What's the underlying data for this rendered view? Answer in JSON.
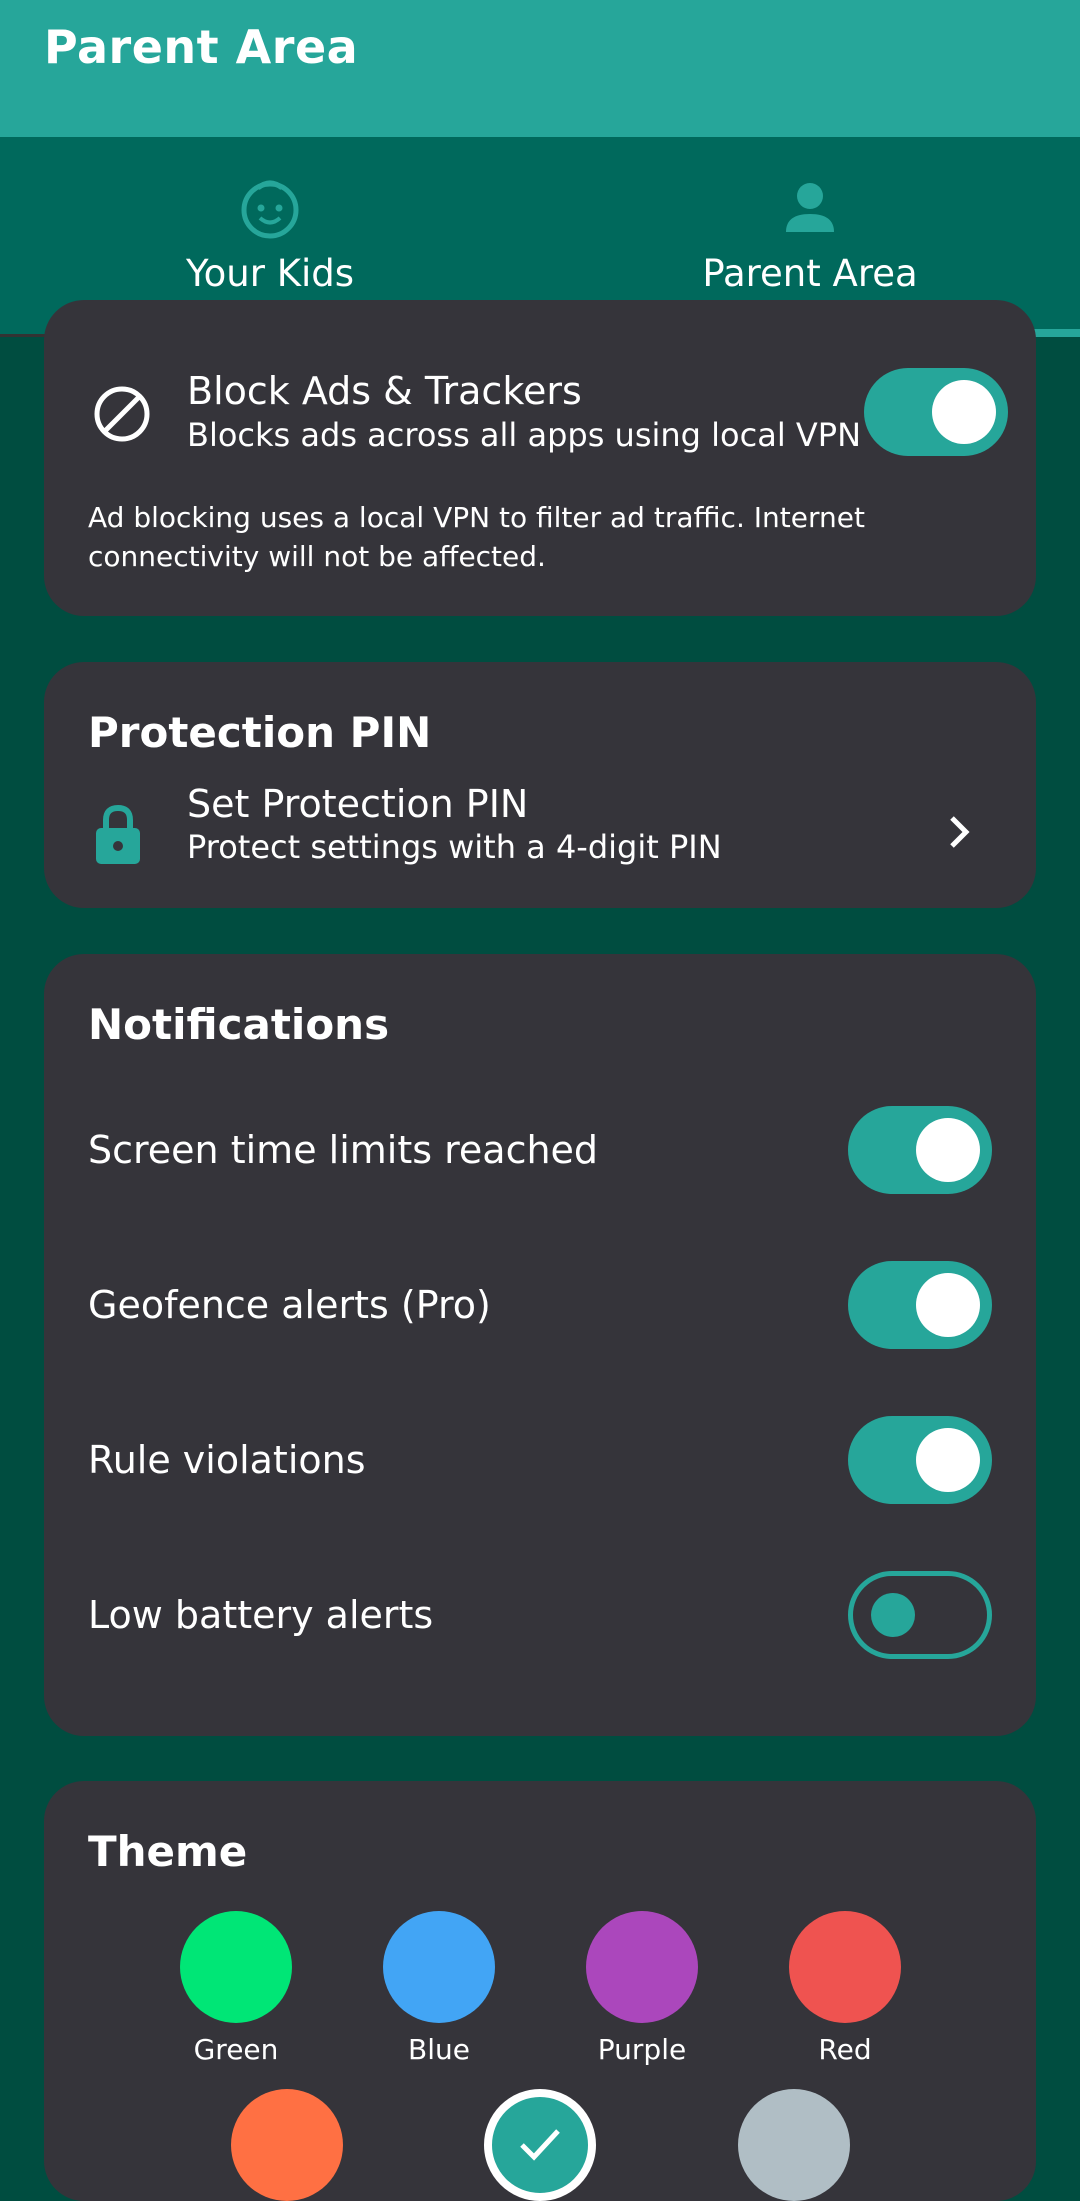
{
  "appbar": {
    "title": "Parent Area"
  },
  "tabs": [
    {
      "label": "Your Kids",
      "icon": "child-face-icon",
      "selected": false
    },
    {
      "label": "Parent Area",
      "icon": "person-icon",
      "selected": true
    }
  ],
  "ad_block": {
    "title": "Block Ads & Trackers",
    "subtitle": "Blocks ads across all apps using local VPN",
    "description_line1": "Ad blocking uses a local VPN to filter ad traffic. Internet",
    "description_line2": "connectivity will not be affected.",
    "enabled": true
  },
  "pin": {
    "section_title": "Protection PIN",
    "title": "Set Protection PIN",
    "subtitle": "Protect settings with a 4-digit PIN"
  },
  "notifications": {
    "section_title": "Notifications",
    "items": [
      {
        "label": "Screen time limits reached",
        "enabled": true
      },
      {
        "label": "Geofence alerts (Pro)",
        "enabled": true
      },
      {
        "label": "Rule violations",
        "enabled": true
      },
      {
        "label": "Low battery alerts",
        "enabled": false
      }
    ]
  },
  "theme": {
    "section_title": "Theme",
    "options": [
      {
        "label": "Green",
        "color": "#00e676"
      },
      {
        "label": "Blue",
        "color": "#42a5f5"
      },
      {
        "label": "Purple",
        "color": "#ab47bc"
      },
      {
        "label": "Red",
        "color": "#ef5350"
      },
      {
        "label": "",
        "color": "#ff7043"
      },
      {
        "label": "",
        "color": "#26a69a",
        "selected": true
      },
      {
        "label": "",
        "color": "#b0bec5"
      }
    ]
  },
  "colors": {
    "accent": "#26a69a",
    "tabbar": "#00695c",
    "background": "#004d40",
    "card": "#35343a"
  }
}
